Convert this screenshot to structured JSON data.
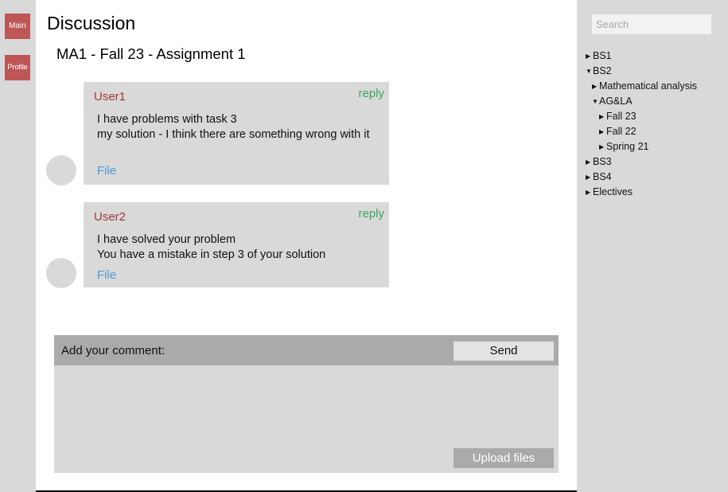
{
  "nav": {
    "main_label": "Main",
    "profile_label": "Profile"
  },
  "page": {
    "title": "Discussion",
    "subtitle": "MA1 - Fall 23 - Assignment 1"
  },
  "posts": [
    {
      "user": "User1",
      "reply_label": "reply",
      "lines": [
        "I have problems with task 3",
        "my solution - I think there are something wrong with it"
      ],
      "file_label": "File"
    },
    {
      "user": "User2",
      "reply_label": "reply",
      "lines": [
        "I have solved your problem",
        "You have a mistake in step 3 of your solution"
      ],
      "file_label": "File"
    }
  ],
  "comment": {
    "label": "Add your comment:",
    "send_label": "Send",
    "upload_label": "Upload files",
    "value": ""
  },
  "sidebar": {
    "search_placeholder": "Search",
    "tree": [
      {
        "label": "BS1",
        "expanded": false
      },
      {
        "label": "BS2",
        "expanded": true
      },
      {
        "label": "Mathematical analysis",
        "expanded": false
      },
      {
        "label": "AG&LA",
        "expanded": true
      },
      {
        "label": "Fall 23",
        "expanded": false
      },
      {
        "label": "Fall 22",
        "expanded": false
      },
      {
        "label": "Spring 21",
        "expanded": false
      },
      {
        "label": "BS3",
        "expanded": false
      },
      {
        "label": "BS4",
        "expanded": false
      },
      {
        "label": "Electives",
        "expanded": false
      }
    ]
  },
  "colors": {
    "nav_button": "#bf5656",
    "username": "#9e3a3a",
    "reply": "#3aa65e",
    "file_link": "#4a9ad4",
    "panel": "#d9d9d9",
    "header_bar": "#aaaaaa"
  }
}
